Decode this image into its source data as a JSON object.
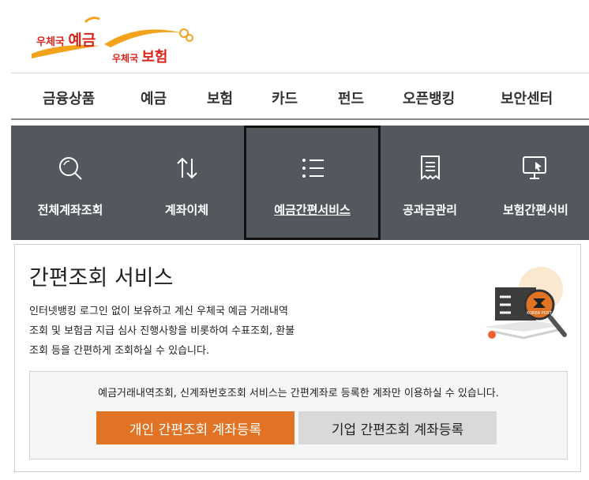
{
  "logo": {
    "line1_prefix": "우체국",
    "line1_main": "예금",
    "line2_prefix": "우체국",
    "line2_main": "보험"
  },
  "topnav": {
    "items": [
      "금융상품",
      "예금",
      "보험",
      "카드",
      "펀드",
      "오픈뱅킹",
      "보안센터"
    ]
  },
  "services": [
    {
      "label": "전체계좌조회",
      "icon": "search-icon"
    },
    {
      "label": "계좌이체",
      "icon": "transfer-arrows-icon"
    },
    {
      "label": "예금간편서비스",
      "icon": "list-icon",
      "active": true
    },
    {
      "label": "공과금관리",
      "icon": "receipt-icon"
    },
    {
      "label": "보험간편서비",
      "icon": "monitor-icon"
    }
  ],
  "content": {
    "title": "간편조회 서비스",
    "desc_lines": [
      "인터넷뱅킹 로그인 없이 보유하고 계신 우체국 예금 거래내역",
      "조회 및 보험금 지급 심사 진행사항을 비롯하여 수표조회, 환불",
      "조회 등을 간편하게 조회하실 수 있습니다."
    ],
    "illustration_text": "KOREA POST",
    "notice": "예금거래내역조회, 신계좌번호조회 서비스는 간편계좌로 등록한 계좌만 이용하실 수 있습니다.",
    "buttons": {
      "personal": "개인 간편조회 계좌등록",
      "business": "기업 간편조회 계좌등록"
    }
  },
  "colors": {
    "brand_red": "#d9261c",
    "brand_orange": "#e07424",
    "service_bar": "#53575e"
  }
}
